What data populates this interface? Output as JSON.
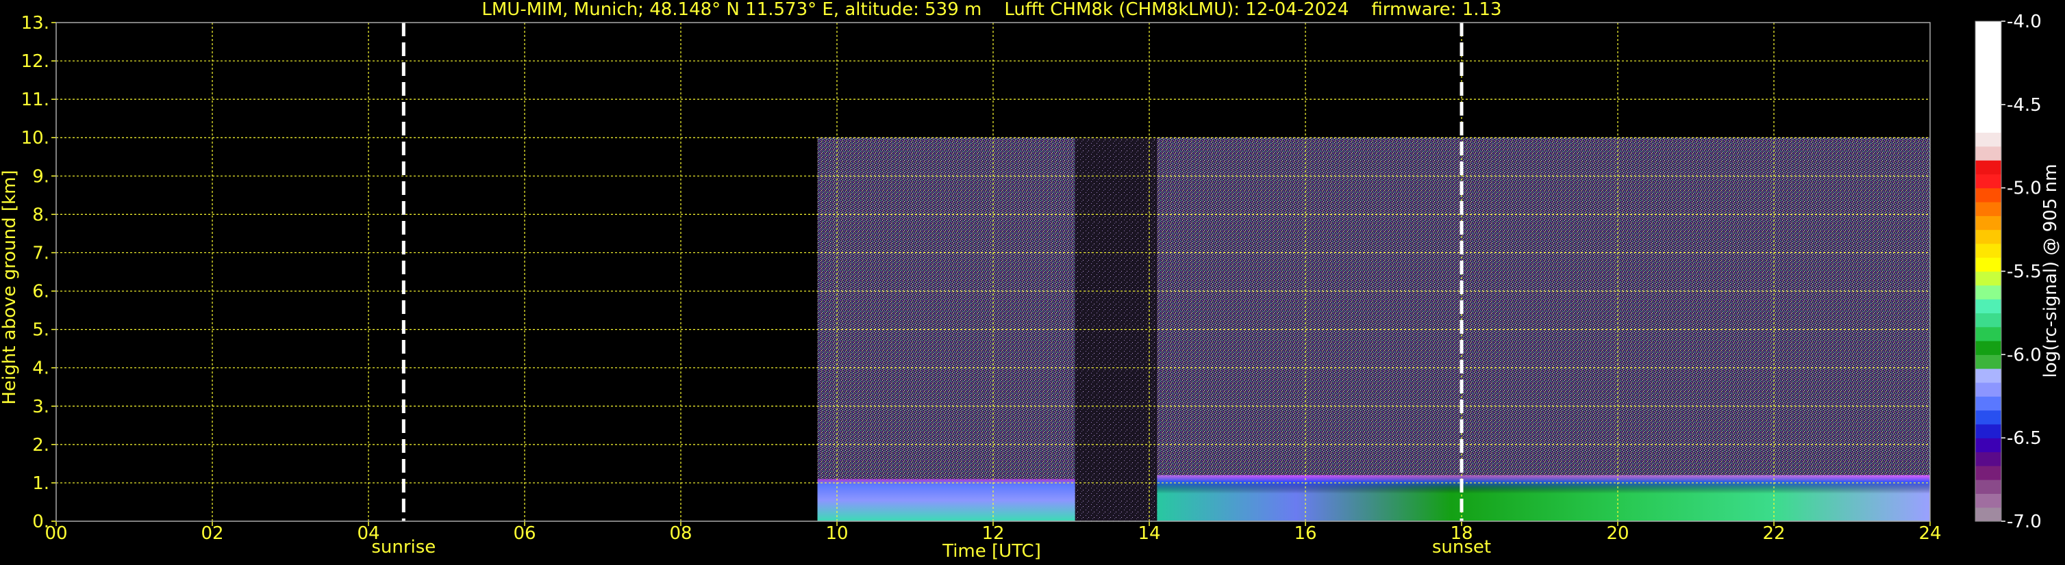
{
  "chart_data": {
    "type": "heatmap",
    "title": "LMU-MIM, Munich; 48.148° N 11.573° E, altitude: 539 m    Lufft CHM8k (CHM8kLMU): 12-04-2024    firmware: 1.13",
    "xlabel": "Time [UTC]",
    "ylabel": "Height above ground [km]",
    "xlim": [
      0,
      24
    ],
    "ylim": [
      0,
      13
    ],
    "x_ticks": [
      "00",
      "02",
      "04",
      "06",
      "08",
      "10",
      "12",
      "14",
      "16",
      "18",
      "20",
      "22",
      "24"
    ],
    "x_tick_values": [
      0,
      2,
      4,
      6,
      8,
      10,
      12,
      14,
      16,
      18,
      20,
      22,
      24
    ],
    "y_ticks": [
      "0.",
      "1.",
      "2.",
      "3.",
      "4.",
      "5.",
      "6.",
      "7.",
      "8.",
      "9.",
      "10.",
      "11.",
      "12.",
      "13."
    ],
    "y_tick_values": [
      0,
      1,
      2,
      3,
      4,
      5,
      6,
      7,
      8,
      9,
      10,
      11,
      12,
      13
    ],
    "grid": true,
    "markers": [
      {
        "label": "sunrise",
        "x": 4.45
      },
      {
        "label": "sunset",
        "x": 18.0
      }
    ],
    "data_segments": [
      {
        "start": 9.75,
        "end": 13.05,
        "top": 10.0,
        "boundary_layer_top": 1.1
      },
      {
        "start": 13.05,
        "end": 14.1,
        "top": 10.0,
        "boundary_layer_top": 0.0
      },
      {
        "start": 14.1,
        "end": 24.0,
        "top": 10.0,
        "boundary_layer_top": 1.2
      }
    ],
    "colorbar": {
      "label": "log(rc-signal) @ 905 nm",
      "range": [
        -7.0,
        -4.0
      ],
      "ticks": [
        "-4.0",
        "-4.5",
        "-5.0",
        "-5.5",
        "-6.0",
        "-6.5",
        "-7.0"
      ],
      "tick_values": [
        -4.0,
        -4.5,
        -5.0,
        -5.5,
        -6.0,
        -6.5,
        -7.0
      ],
      "colors": [
        "#a08aa0",
        "#a06ea0",
        "#8a4a8a",
        "#781e78",
        "#5a0a8a",
        "#3c00b4",
        "#1e1ed2",
        "#2850f0",
        "#5a78ff",
        "#8c96ff",
        "#aab4ff",
        "#3cb43c",
        "#14a014",
        "#28c850",
        "#3cdc8c",
        "#50f0b4",
        "#8cff8c",
        "#c8ff3c",
        "#ffff00",
        "#ffe600",
        "#ffc800",
        "#ffa000",
        "#ff7800",
        "#ff5000",
        "#ff1e1e",
        "#f01414",
        "#f0c8c8",
        "#f5e6e6",
        "#ffffff",
        "#ffffff",
        "#ffffff",
        "#ffffff",
        "#ffffff",
        "#ffffff",
        "#ffffff",
        "#ffffff"
      ]
    }
  }
}
